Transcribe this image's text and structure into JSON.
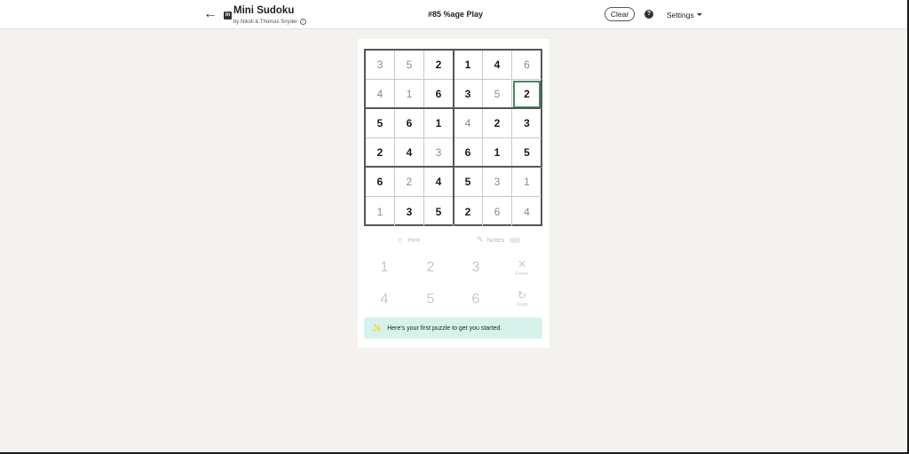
{
  "header": {
    "back_icon": "arrow-left-icon",
    "brand_icon": "linkedin-icon",
    "brand_icon_text": "in",
    "title": "Mini Sudoku",
    "byline": "by Nikoli & Thomas Snyder",
    "info_icon_glyph": "i",
    "game_id": "#85 %age Play",
    "clear_label": "Clear",
    "help_glyph": "?",
    "settings_label": "Settings"
  },
  "board": {
    "size": 6,
    "cells": [
      [
        {
          "v": "3",
          "given": false
        },
        {
          "v": "5",
          "given": false
        },
        {
          "v": "2",
          "given": true
        },
        {
          "v": "1",
          "given": true
        },
        {
          "v": "4",
          "given": true
        },
        {
          "v": "6",
          "given": false
        }
      ],
      [
        {
          "v": "4",
          "given": false
        },
        {
          "v": "1",
          "given": false
        },
        {
          "v": "6",
          "given": true
        },
        {
          "v": "3",
          "given": true
        },
        {
          "v": "5",
          "given": false
        },
        {
          "v": "2",
          "given": true,
          "selected": true
        }
      ],
      [
        {
          "v": "5",
          "given": true
        },
        {
          "v": "6",
          "given": true
        },
        {
          "v": "1",
          "given": true
        },
        {
          "v": "4",
          "given": false
        },
        {
          "v": "2",
          "given": true
        },
        {
          "v": "3",
          "given": true
        }
      ],
      [
        {
          "v": "2",
          "given": true
        },
        {
          "v": "4",
          "given": true
        },
        {
          "v": "3",
          "given": false
        },
        {
          "v": "6",
          "given": true
        },
        {
          "v": "1",
          "given": true
        },
        {
          "v": "5",
          "given": true
        }
      ],
      [
        {
          "v": "6",
          "given": true
        },
        {
          "v": "2",
          "given": false
        },
        {
          "v": "4",
          "given": true
        },
        {
          "v": "5",
          "given": true
        },
        {
          "v": "3",
          "given": false
        },
        {
          "v": "1",
          "given": false
        }
      ],
      [
        {
          "v": "1",
          "given": false
        },
        {
          "v": "3",
          "given": true
        },
        {
          "v": "5",
          "given": true
        },
        {
          "v": "2",
          "given": true
        },
        {
          "v": "6",
          "given": false
        },
        {
          "v": "4",
          "given": false
        }
      ]
    ]
  },
  "tools": {
    "hint_label": "Hint",
    "hint_icon": "lightbulb-icon",
    "notes_label": "Notes",
    "notes_icon": "pencil-icon"
  },
  "keypad": {
    "numbers": [
      "1",
      "2",
      "3",
      "4",
      "5",
      "6"
    ],
    "erase_label": "Erase",
    "erase_icon": "close-icon",
    "undo_label": "Undo",
    "undo_icon": "undo-icon"
  },
  "banner": {
    "icon": "magic-wand-icon",
    "message": "Here's your first puzzle to get you started."
  },
  "colors": {
    "background": "#f3f2ef",
    "selected_cell_border": "#3d8f5c",
    "banner_bg": "#d5f3ea"
  }
}
